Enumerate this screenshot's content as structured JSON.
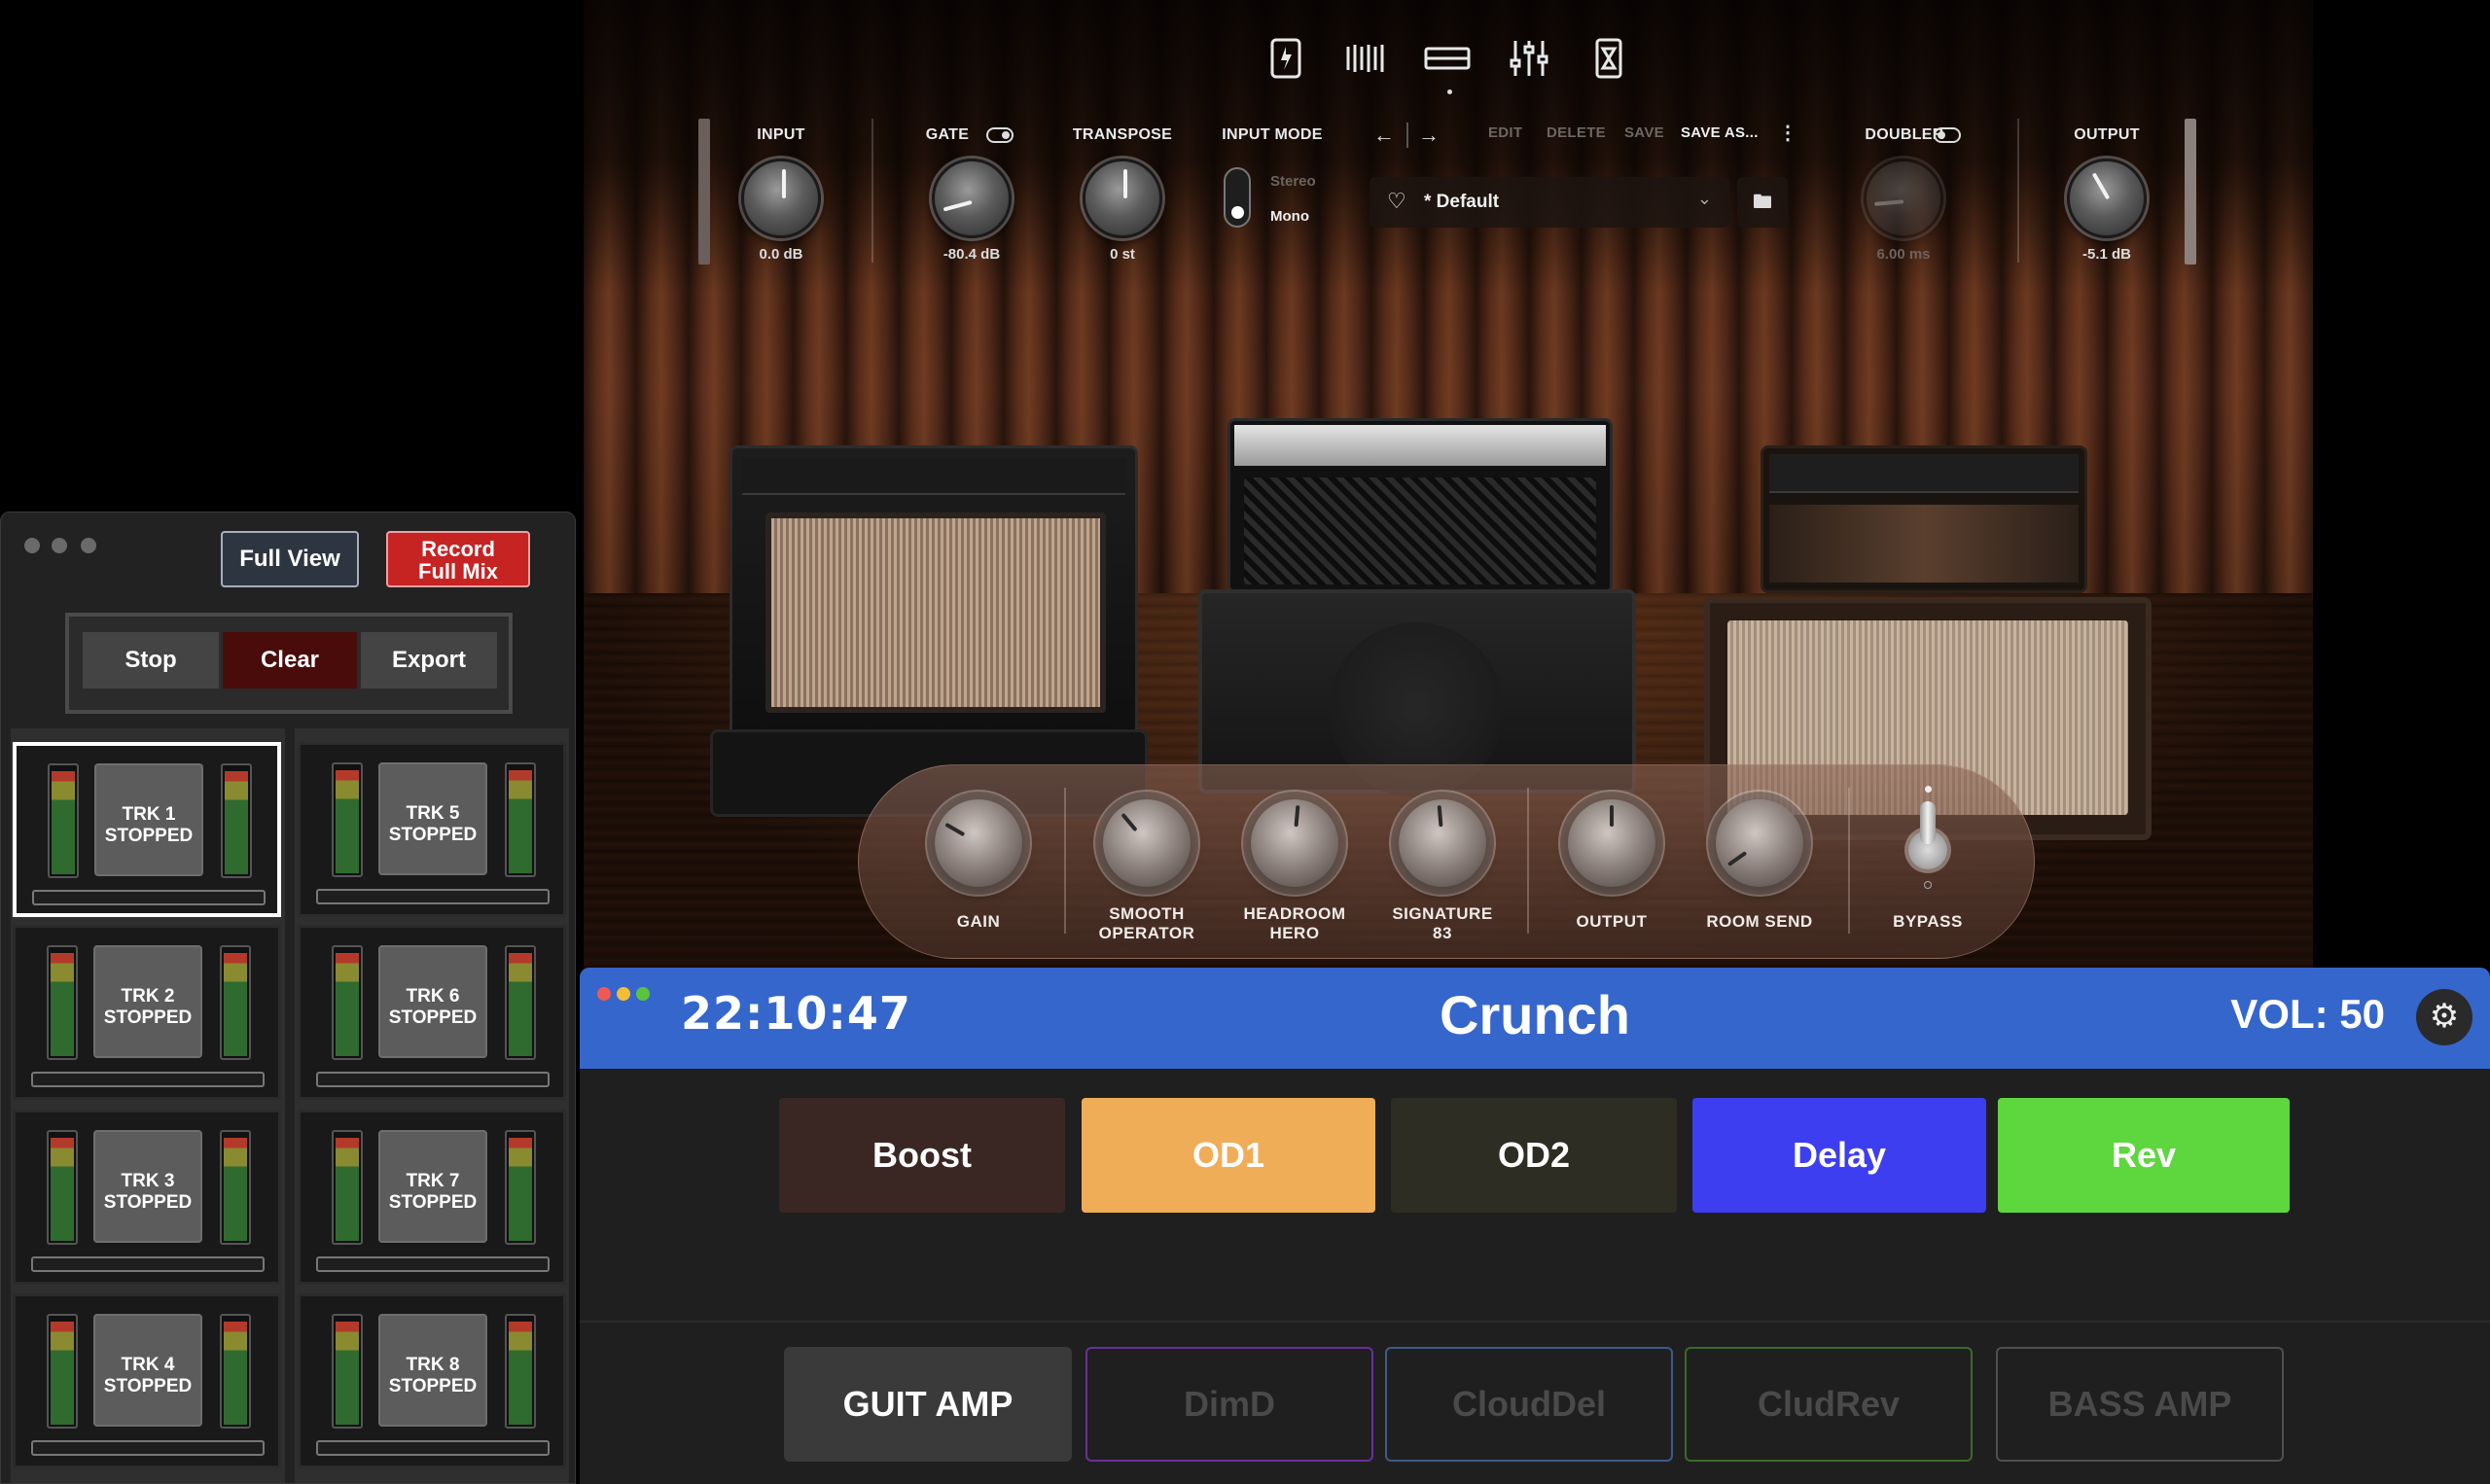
{
  "plugin": {
    "controls": {
      "input": {
        "label": "INPUT",
        "value": "0.0 dB"
      },
      "gate": {
        "label": "GATE",
        "value": "-80.4 dB"
      },
      "transpose": {
        "label": "TRANSPOSE",
        "value": "0 st"
      },
      "input_mode": {
        "label": "INPUT MODE",
        "option_stereo": "Stereo",
        "option_mono": "Mono",
        "selected": "Mono"
      },
      "doubler": {
        "label": "DOUBLER",
        "value": "6.00 ms"
      },
      "output": {
        "label": "OUTPUT",
        "value": "-5.1 dB"
      }
    },
    "preset_actions": {
      "edit": "EDIT",
      "delete": "DELETE",
      "save": "SAVE",
      "save_as": "SAVE AS..."
    },
    "preset": {
      "name": "* Default"
    },
    "strip": {
      "gain": "GAIN",
      "smooth_operator": "SMOOTH\nOPERATOR",
      "headroom_hero": "HEADROOM\nHERO",
      "signature_83": "SIGNATURE\n83",
      "output": "OUTPUT",
      "room_send": "ROOM SEND",
      "bypass": "BYPASS"
    }
  },
  "looper": {
    "full_view": "Full View",
    "record_line1": "Record",
    "record_line2": "Full Mix",
    "stop": "Stop",
    "clear": "Clear",
    "export": "Export",
    "tracks": [
      {
        "name": "TRK 1",
        "status": "STOPPED"
      },
      {
        "name": "TRK 2",
        "status": "STOPPED"
      },
      {
        "name": "TRK 3",
        "status": "STOPPED"
      },
      {
        "name": "TRK 4",
        "status": "STOPPED"
      },
      {
        "name": "TRK 5",
        "status": "STOPPED"
      },
      {
        "name": "TRK 6",
        "status": "STOPPED"
      },
      {
        "name": "TRK 7",
        "status": "STOPPED"
      },
      {
        "name": "TRK 8",
        "status": "STOPPED"
      }
    ]
  },
  "controller": {
    "clock": "22:10:47",
    "preset": "Crunch",
    "volume": "VOL: 50",
    "effects": [
      {
        "label": "Boost",
        "color": "#3a2723"
      },
      {
        "label": "OD1",
        "color": "#f0ad58"
      },
      {
        "label": "OD2",
        "color": "#2d2d24"
      },
      {
        "label": "Delay",
        "color": "#3d3ef0"
      },
      {
        "label": "Rev",
        "color": "#5ed63e"
      }
    ],
    "pages": [
      {
        "label": "GUIT AMP",
        "active": true
      },
      {
        "label": "DimD",
        "border": "#6a2f9a"
      },
      {
        "label": "CloudDel",
        "border": "#3c5a8a"
      },
      {
        "label": "CludRev",
        "border": "#3a6a2a"
      },
      {
        "label": "BASS AMP",
        "border": "#505050"
      }
    ]
  }
}
